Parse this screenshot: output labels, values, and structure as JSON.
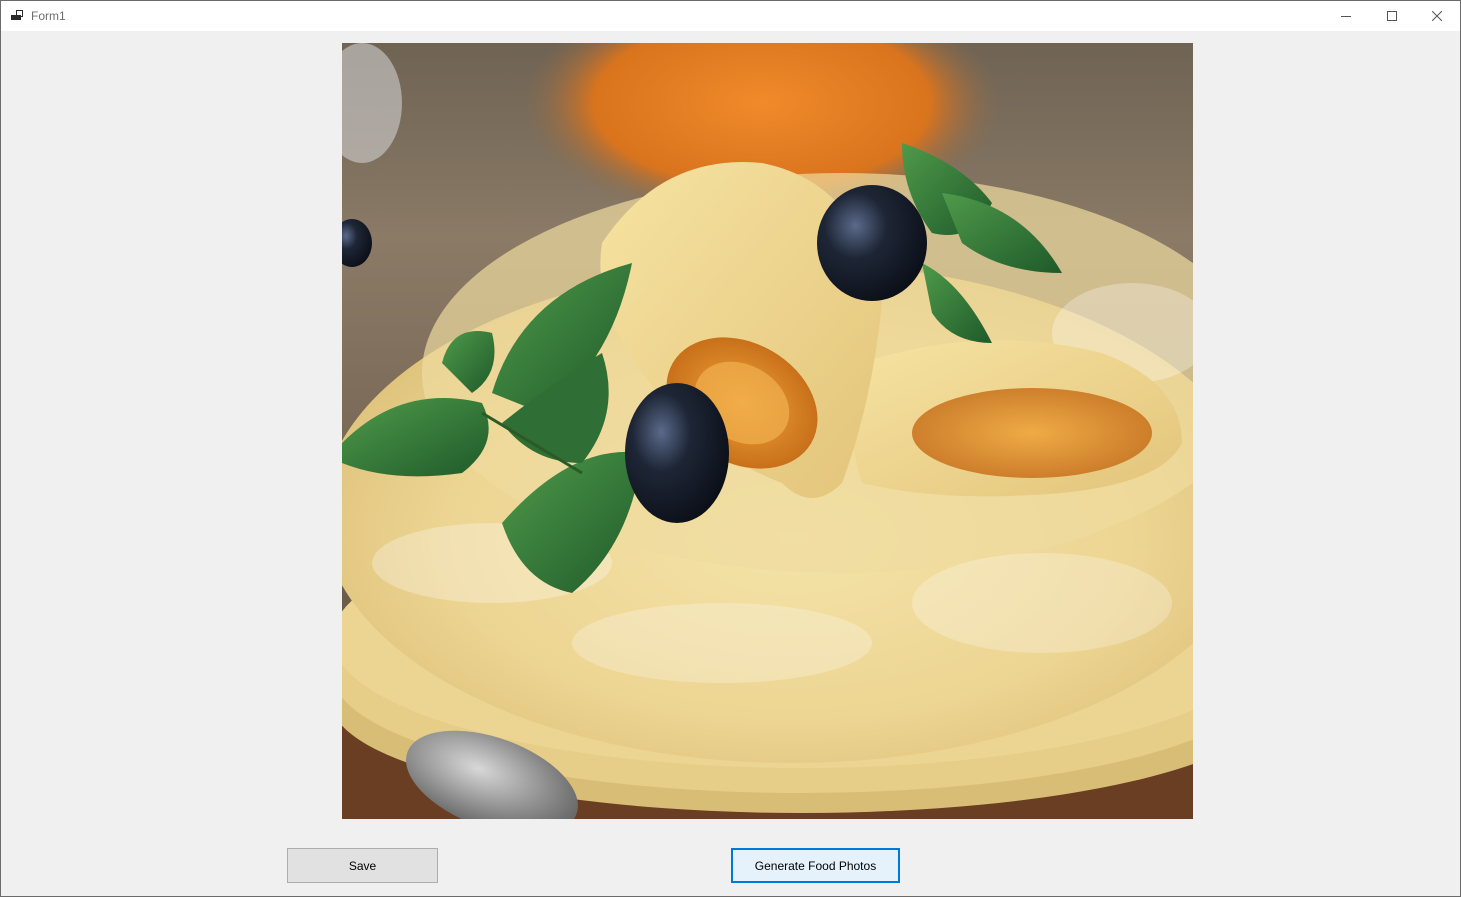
{
  "window": {
    "title": "Form1"
  },
  "picture": {
    "icon": "food-photo-crepes"
  },
  "buttons": {
    "save_label": "Save",
    "generate_label": "Generate Food Photos"
  },
  "colors": {
    "accent": "#0078d7",
    "window_bg": "#f0f0f0",
    "button_bg": "#e1e1e1"
  }
}
